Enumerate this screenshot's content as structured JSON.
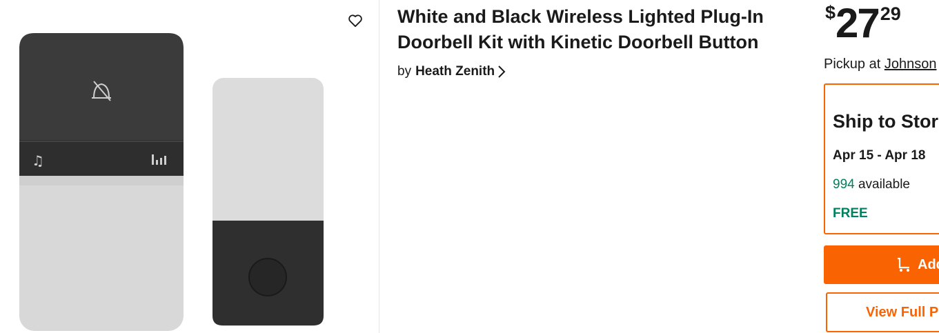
{
  "product": {
    "title_line1": "White and Black Wireless Lighted Plug-In",
    "title_line2": "Doorbell Kit with Kinetic Doorbell Button",
    "by_label": "by",
    "brand": "Heath Zenith"
  },
  "pricing": {
    "currency": "$",
    "dollars": "27",
    "cents": "29"
  },
  "fulfillment": {
    "pickup_label": "Pickup at",
    "pickup_store": "Johnson",
    "ship_title": "Ship to Stor",
    "ship_dates": "Apr 15 - Apr 18",
    "available_count": "994",
    "available_label": "available",
    "ship_cost": "FREE"
  },
  "actions": {
    "add_to_cart_label": "Add",
    "view_full_label": "View Full P"
  },
  "colors": {
    "accent": "#f96302",
    "success": "#00805f",
    "receiver_dark": "#3a3a3a",
    "receiver_light": "#d9d9d9"
  },
  "icons": {
    "favorite": "heart-outline-icon",
    "brand_chevron": "chevron-right-icon",
    "cart": "cart-icon"
  }
}
